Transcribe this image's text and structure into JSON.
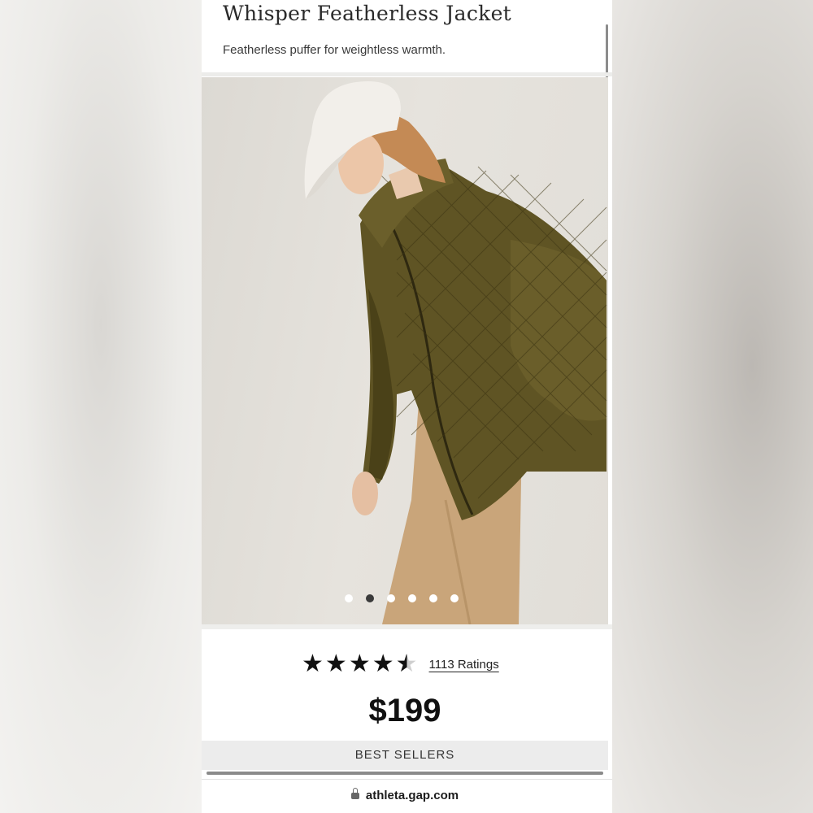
{
  "product": {
    "title": "Whisper Featherless Jacket",
    "subtitle": "Featherless puffer for weightless warmth.",
    "image_alt": "Woman in white cap and olive quilted jacket",
    "carousel": {
      "total": 6,
      "active_index": 1
    },
    "rating": {
      "stars": 4.5,
      "count_label": "1113 Ratings"
    },
    "price": "$199"
  },
  "best_sellers": {
    "label": "BEST SELLERS",
    "scroll_progress": 1.0
  },
  "browser": {
    "url": "athleta.gap.com"
  },
  "icons": {
    "lock": "lock-icon",
    "star": "star-icon"
  },
  "colors": {
    "jacket": "#5f5424",
    "pants": "#c9a57a",
    "cap": "#f2efea",
    "active_dot": "#3a3a3a"
  }
}
